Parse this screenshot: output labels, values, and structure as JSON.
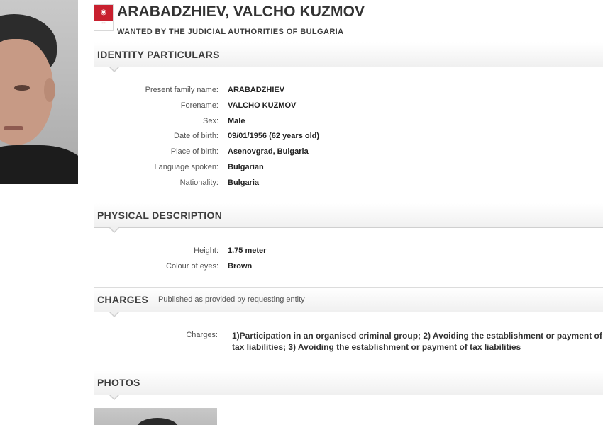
{
  "header": {
    "name": "ARABADZHIEV, VALCHO KUZMOV",
    "subtitle": "WANTED BY THE JUDICIAL AUTHORITIES OF BULGARIA"
  },
  "identity": {
    "title": "IDENTITY PARTICULARS",
    "rows": [
      {
        "label": "Present family name:",
        "value": "ARABADZHIEV"
      },
      {
        "label": "Forename:",
        "value": "VALCHO KUZMOV"
      },
      {
        "label": "Sex:",
        "value": "Male"
      },
      {
        "label": "Date of birth:",
        "value": "09/01/1956 (62 years old)"
      },
      {
        "label": "Place of birth:",
        "value": "Asenovgrad, Bulgaria"
      },
      {
        "label": "Language spoken:",
        "value": "Bulgarian"
      },
      {
        "label": "Nationality:",
        "value": "Bulgaria"
      }
    ]
  },
  "physical": {
    "title": "PHYSICAL DESCRIPTION",
    "rows": [
      {
        "label": "Height:",
        "value": "1.75 meter"
      },
      {
        "label": "Colour of eyes:",
        "value": "Brown"
      }
    ]
  },
  "charges": {
    "title": "CHARGES",
    "note": "Published as provided by requesting entity",
    "label": "Charges:",
    "line1": "1)Participation in an organised criminal group; 2) Avoiding the establishment or payment of",
    "line2": "tax liabilities; 3) Avoiding the establishment or payment of tax liabilities"
  },
  "photos": {
    "title": "PHOTOS"
  },
  "colors": {
    "emblem_red": "#c8202f",
    "section_border": "#cfcfcf"
  }
}
